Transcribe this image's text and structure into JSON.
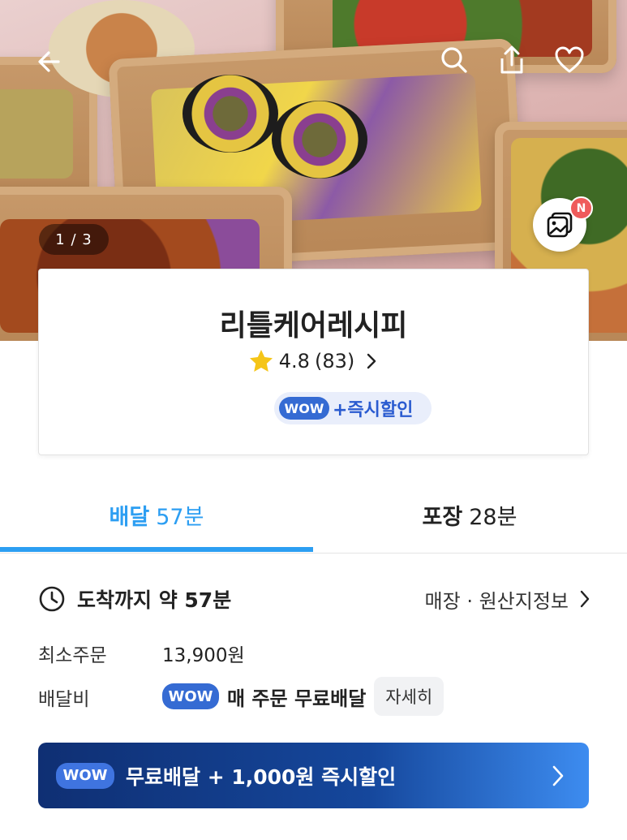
{
  "hero": {
    "page_indicator": "1 / 3",
    "new_badge": "N",
    "icons": {
      "back": "arrow-left-icon",
      "search": "search-icon",
      "share": "share-icon",
      "favorite": "heart-icon",
      "gallery": "photo-gallery-icon"
    }
  },
  "store": {
    "name": "리틀케어레시피",
    "rating": "4.8",
    "review_count": "(83)",
    "wow_label": "WOW",
    "wow_promo": "+즉시할인"
  },
  "tabs": [
    {
      "label": "배달",
      "time": "57분",
      "active": true
    },
    {
      "label": "포장",
      "time": "28분",
      "active": false
    }
  ],
  "info": {
    "arrival_text": "도착까지 약 57분",
    "store_info_link": "매장 · 원산지정보",
    "min_order_label": "최소주문",
    "min_order_value": "13,900원",
    "delivery_fee_label": "배달비",
    "delivery_fee_wow": "WOW",
    "delivery_fee_text": "매 주문 무료배달",
    "details_button": "자세히"
  },
  "promo_banner": {
    "wow": "WOW",
    "text": "무료배달 + 1,000원 즉시할인"
  },
  "colors": {
    "accent_blue": "#2c9ef2",
    "wow_blue": "#356bd3",
    "banner_dark": "#0f2f73",
    "badge_red": "#ef5b5b",
    "star_yellow": "#f5c518"
  }
}
